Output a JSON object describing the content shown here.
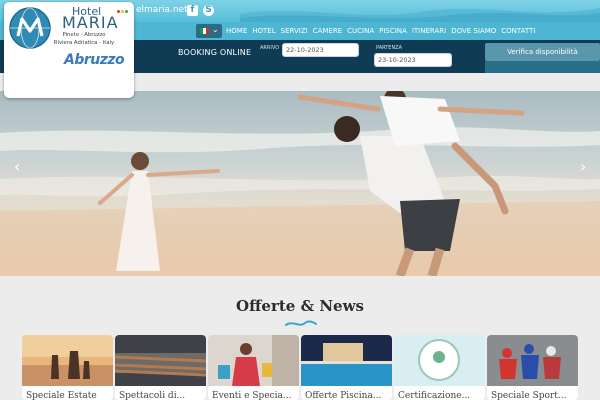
{
  "header": {
    "email_text": "elmaria.net",
    "social": [
      {
        "icon": "facebook-icon",
        "glyph": "f"
      },
      {
        "icon": "skype-icon",
        "glyph": "S"
      }
    ]
  },
  "logo": {
    "hotel": "Hotel",
    "name": "MARIA",
    "address_line1": "Pineto - Abruzzo",
    "address_line2": "Riviera Adriatica - Italy",
    "region": "Abruzzo"
  },
  "language": {
    "selected_icon": "italy-flag-icon",
    "caret": "⌄"
  },
  "nav": {
    "items": [
      "HOME",
      "HOTEL",
      "SERVIZI",
      "CAMERE",
      "CUCINA",
      "PISCINA",
      "ITINERARI",
      "DOVE SIAMO",
      "CONTATTI"
    ]
  },
  "booking": {
    "title": "BOOKING ONLINE",
    "arrival_label": "Arrivo",
    "arrival_value": "22-10-2023",
    "departure_label": "Partenza",
    "departure_value": "23-10-2023",
    "verify_label": "Verifica disponibilità"
  },
  "hero": {
    "prev": "‹",
    "next": "›"
  },
  "offers": {
    "title": "Offerte & News",
    "cards": [
      {
        "caption": "Speciale Estate",
        "image": "family-beach-sunset"
      },
      {
        "caption": "Spettacoli di...",
        "image": "grill-skewers"
      },
      {
        "caption": "Eventi e Specia...",
        "image": "woman-shopping-bags"
      },
      {
        "caption": "Offerte Piscina...",
        "image": "hotel-pool-night"
      },
      {
        "caption": "Certificazione...",
        "image": "eco-certificate"
      },
      {
        "caption": "Speciale Sport...",
        "image": "cyclists-race"
      }
    ]
  },
  "colors": {
    "top_strip": "#56bfd9",
    "nav_bar": "#4eb6d3",
    "booking_bar": "#0f3b54",
    "logo_text": "#2b6080",
    "accent_wave": "#3aa8c8"
  }
}
